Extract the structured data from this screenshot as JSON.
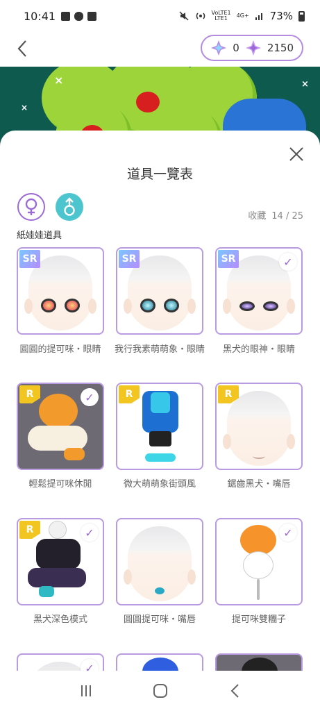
{
  "status": {
    "time": "10:41",
    "battery": "73%",
    "net": "4G+",
    "volte": "VoLTE1",
    "lte": "LTE1"
  },
  "currency": {
    "value_a": "0",
    "value_b": "2150"
  },
  "sheet": {
    "title": "道具一覽表",
    "collect_label": "收藏",
    "collect_count": "14 / 25",
    "section_label": "紙娃娃道具"
  },
  "items": [
    {
      "rarity": "SR",
      "name": "圓圓的提可咪・眼睛",
      "owned": false
    },
    {
      "rarity": "SR",
      "name": "我行我素萌萌象・眼睛",
      "owned": false
    },
    {
      "rarity": "SR",
      "name": "黑犬的眼神・眼睛",
      "owned": true
    },
    {
      "rarity": "R",
      "name": "輕鬆提可咪休閒",
      "owned": true
    },
    {
      "rarity": "R",
      "name": "微大萌萌象街頭風",
      "owned": false
    },
    {
      "rarity": "R",
      "name": "鋸齒黑犬・嘴唇",
      "owned": false
    },
    {
      "rarity": "R",
      "name": "黑犬深色模式",
      "owned": true
    },
    {
      "rarity": "",
      "name": "圓圓提可咪・嘴唇",
      "owned": false
    },
    {
      "rarity": "",
      "name": "提可咪雙糰子",
      "owned": true
    }
  ],
  "colors": {
    "accent": "#9b6ad6",
    "male": "#4cc5cf",
    "rarity_r": "#f3c521",
    "banner": "#0e5a4f"
  }
}
